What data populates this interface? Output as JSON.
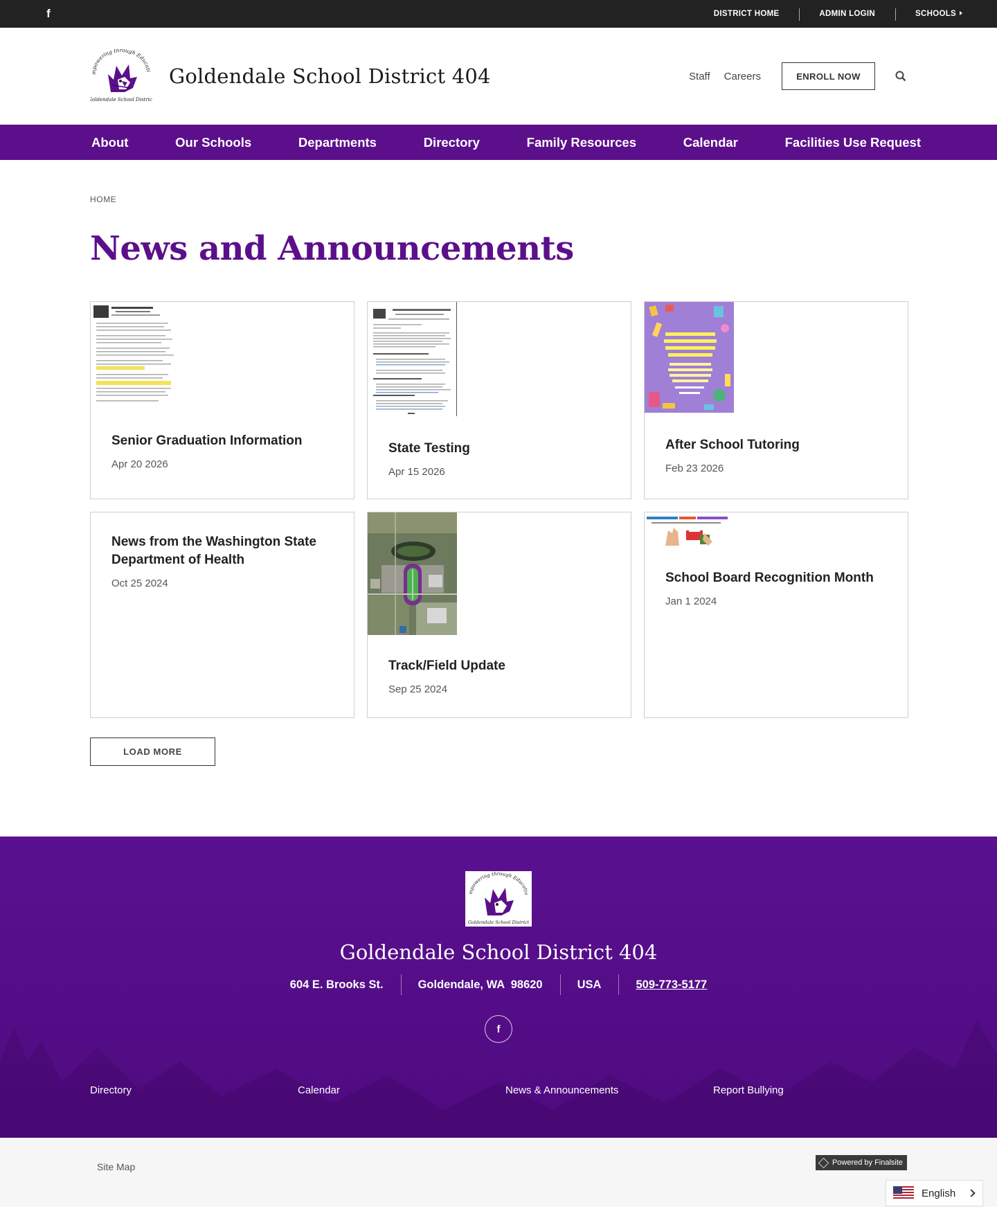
{
  "topbar": {
    "facebook_icon": "facebook-icon",
    "links": [
      "DISTRICT HOME",
      "ADMIN LOGIN",
      "SCHOOLS"
    ]
  },
  "header": {
    "title": "Goldendale School District 404",
    "logo_text_top": "Empowering through Education",
    "logo_text_bottom": "Goldendale School District",
    "links": [
      "Staff",
      "Careers"
    ],
    "enroll_label": "ENROLL NOW",
    "search_icon": "search-icon"
  },
  "nav": {
    "items": [
      "About",
      "Our Schools",
      "Departments",
      "Directory",
      "Family Resources",
      "Calendar",
      "Facilities Use Request"
    ]
  },
  "breadcrumb": "HOME",
  "page_title": "News and Announcements",
  "cards": [
    {
      "title": "Senior Graduation Information",
      "date": "Apr 20 2026",
      "thumb": "document"
    },
    {
      "title": "State Testing",
      "date": "Apr 15 2026",
      "thumb": "document"
    },
    {
      "title": "After School Tutoring",
      "date": "Feb 23 2026",
      "thumb": "flyer"
    },
    {
      "title": "News from the Washington State Department of Health",
      "date": "Oct 25 2024",
      "thumb": "none"
    },
    {
      "title": "Track/Field Update",
      "date": "Sep 25 2024",
      "thumb": "aerial"
    },
    {
      "title": "School Board Recognition Month",
      "date": "Jan 1 2024",
      "thumb": "banner"
    }
  ],
  "load_more_label": "LOAD MORE",
  "footer": {
    "title": "Goldendale School District 404",
    "address": [
      "604 E. Brooks St.",
      "Goldendale, WA  98620",
      "USA",
      "509-773-5177"
    ],
    "links": [
      "Directory",
      "Calendar",
      "News & Announcements",
      "Report Bullying"
    ]
  },
  "bottom": {
    "sitemap": "Site Map",
    "powered": "Powered by Finalsite",
    "language": "English"
  },
  "colors": {
    "brand_purple": "#5c0f8b",
    "topbar": "#222222"
  }
}
